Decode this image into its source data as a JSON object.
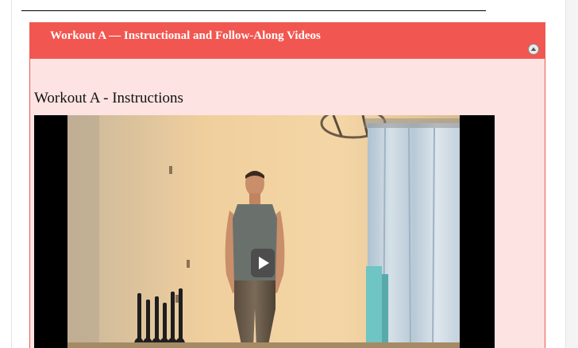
{
  "panel": {
    "title": "Workout A — Instructional and Follow-Along Videos",
    "collapse_icon": "collapse-up-icon"
  },
  "section": {
    "heading": "Workout A - Instructions"
  },
  "video": {
    "play_icon": "play-icon"
  },
  "colors": {
    "header_red": "#f25650",
    "panel_background": "#fde3e2",
    "panel_border": "#e65a52",
    "player_background": "#000000"
  }
}
